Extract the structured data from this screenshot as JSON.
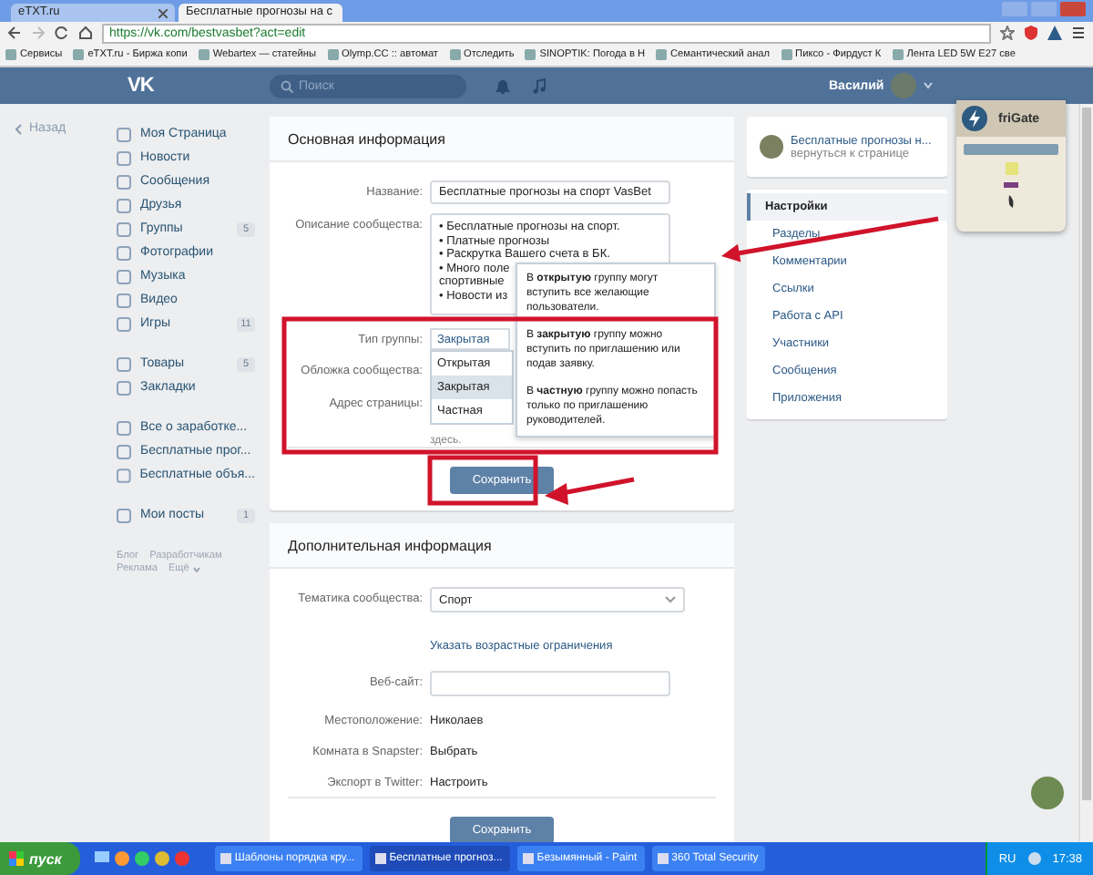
{
  "browser": {
    "tabs": [
      {
        "title": "eTXT.ru",
        "selected": false
      },
      {
        "title": "Бесплатные прогнозы на с",
        "selected": true
      }
    ],
    "url": "https://vk.com/bestvasbet?act=edit",
    "bookmarks": [
      "Сервисы",
      "eTXT.ru - Биржа копи",
      "Webartex — статейны",
      "Olymp.CC :: автомат",
      "Отследить",
      "SINOPTIK: Погода в Н",
      "Семантический анал",
      "Пиксо - Фирдуст К",
      "Лента LED 5W E27 све"
    ]
  },
  "header": {
    "logo": "VK",
    "search_placeholder": "Поиск",
    "user": "Василий"
  },
  "back_link": "Назад",
  "sidebar": {
    "sections": [
      [
        {
          "label": "Моя Страница"
        },
        {
          "label": "Новости"
        },
        {
          "label": "Сообщения"
        },
        {
          "label": "Друзья"
        },
        {
          "label": "Группы",
          "badge": "5"
        },
        {
          "label": "Фотографии"
        },
        {
          "label": "Музыка"
        },
        {
          "label": "Видео"
        },
        {
          "label": "Игры",
          "badge": "11"
        }
      ],
      [
        {
          "label": "Товары",
          "badge": "5"
        },
        {
          "label": "Закладки"
        }
      ],
      [
        {
          "label": "Все о заработке..."
        },
        {
          "label": "Бесплатные прог..."
        },
        {
          "label": "Бесплатные объя..."
        }
      ],
      [
        {
          "label": "Мои посты",
          "badge": "1"
        }
      ]
    ],
    "footer_links": [
      "Блог",
      "Разработчикам",
      "Реклама",
      "Ещё"
    ]
  },
  "main": {
    "title": "Основная информация",
    "name_label": "Название:",
    "name_value": "Бесплатные прогнозы на спорт VasBet",
    "description_label": "Описание сообщества:",
    "description_lines": [
      "• Бесплатные прогнозы на спорт.",
      "• Платные прогнозы",
      "• Раскрутка Вашего счета в БК.",
      "• Много поле",
      "спортивные",
      "• Новости из"
    ],
    "type_label": "Тип группы:",
    "type_value": "Закрытая",
    "type_options": [
      {
        "label": "Открытая",
        "selected": false
      },
      {
        "label": "Закрытая",
        "selected": true
      },
      {
        "label": "Частная",
        "selected": false
      }
    ],
    "cover_label": "Обложка сообщества:",
    "address_label": "Адрес страницы:",
    "address_hint": "здесь.",
    "tooltip": [
      "В **открытую** группу могут вступить все желающие пользователи.",
      "В **закрытую** группу можно вступить по приглашению или подав заявку.",
      "В **частную** группу можно попасть только по приглашению руководителей."
    ],
    "save": "Сохранить"
  },
  "extra": {
    "title": "Дополнительная информация",
    "rows": [
      {
        "kind": "select",
        "label": "Тематика сообщества:",
        "value": "Спорт"
      },
      {
        "kind": "link",
        "value": "Указать возрастные ограничения"
      },
      {
        "kind": "input",
        "label": "Веб-сайт:"
      },
      {
        "kind": "text",
        "label": "Местоположение:",
        "value": "Николаев"
      },
      {
        "kind": "text",
        "label": "Комната в Snapster:",
        "value": "Выбрать"
      },
      {
        "kind": "text",
        "label": "Экспорт в Twitter:",
        "value": "Настроить"
      }
    ],
    "save": "Сохранить"
  },
  "group_menu": {
    "name": "Бесплатные прогнозы н...",
    "back": "вернуться к странице",
    "items": [
      {
        "label": "Настройки",
        "selected": true
      },
      {
        "label": "Разделы",
        "selected": false
      },
      {
        "label": "Комментарии",
        "selected": false
      },
      {
        "label": "Ссылки",
        "selected": false
      },
      {
        "label": "Работа с API",
        "selected": false
      },
      {
        "label": "Участники",
        "selected": false
      },
      {
        "label": "Сообщения",
        "selected": false
      },
      {
        "label": "Приложения",
        "selected": false
      }
    ]
  },
  "frigate": {
    "title": "friGate"
  },
  "taskbar": {
    "start": "пуск",
    "windows": [
      {
        "title": "Шаблоны порядка кру...",
        "selected": false
      },
      {
        "title": "Бесплатные прогноз...",
        "selected": true
      },
      {
        "title": "Безымянный - Paint",
        "selected": false
      },
      {
        "title": "360 Total Security",
        "selected": false
      }
    ],
    "lang": "RU",
    "clock": "17:38"
  }
}
